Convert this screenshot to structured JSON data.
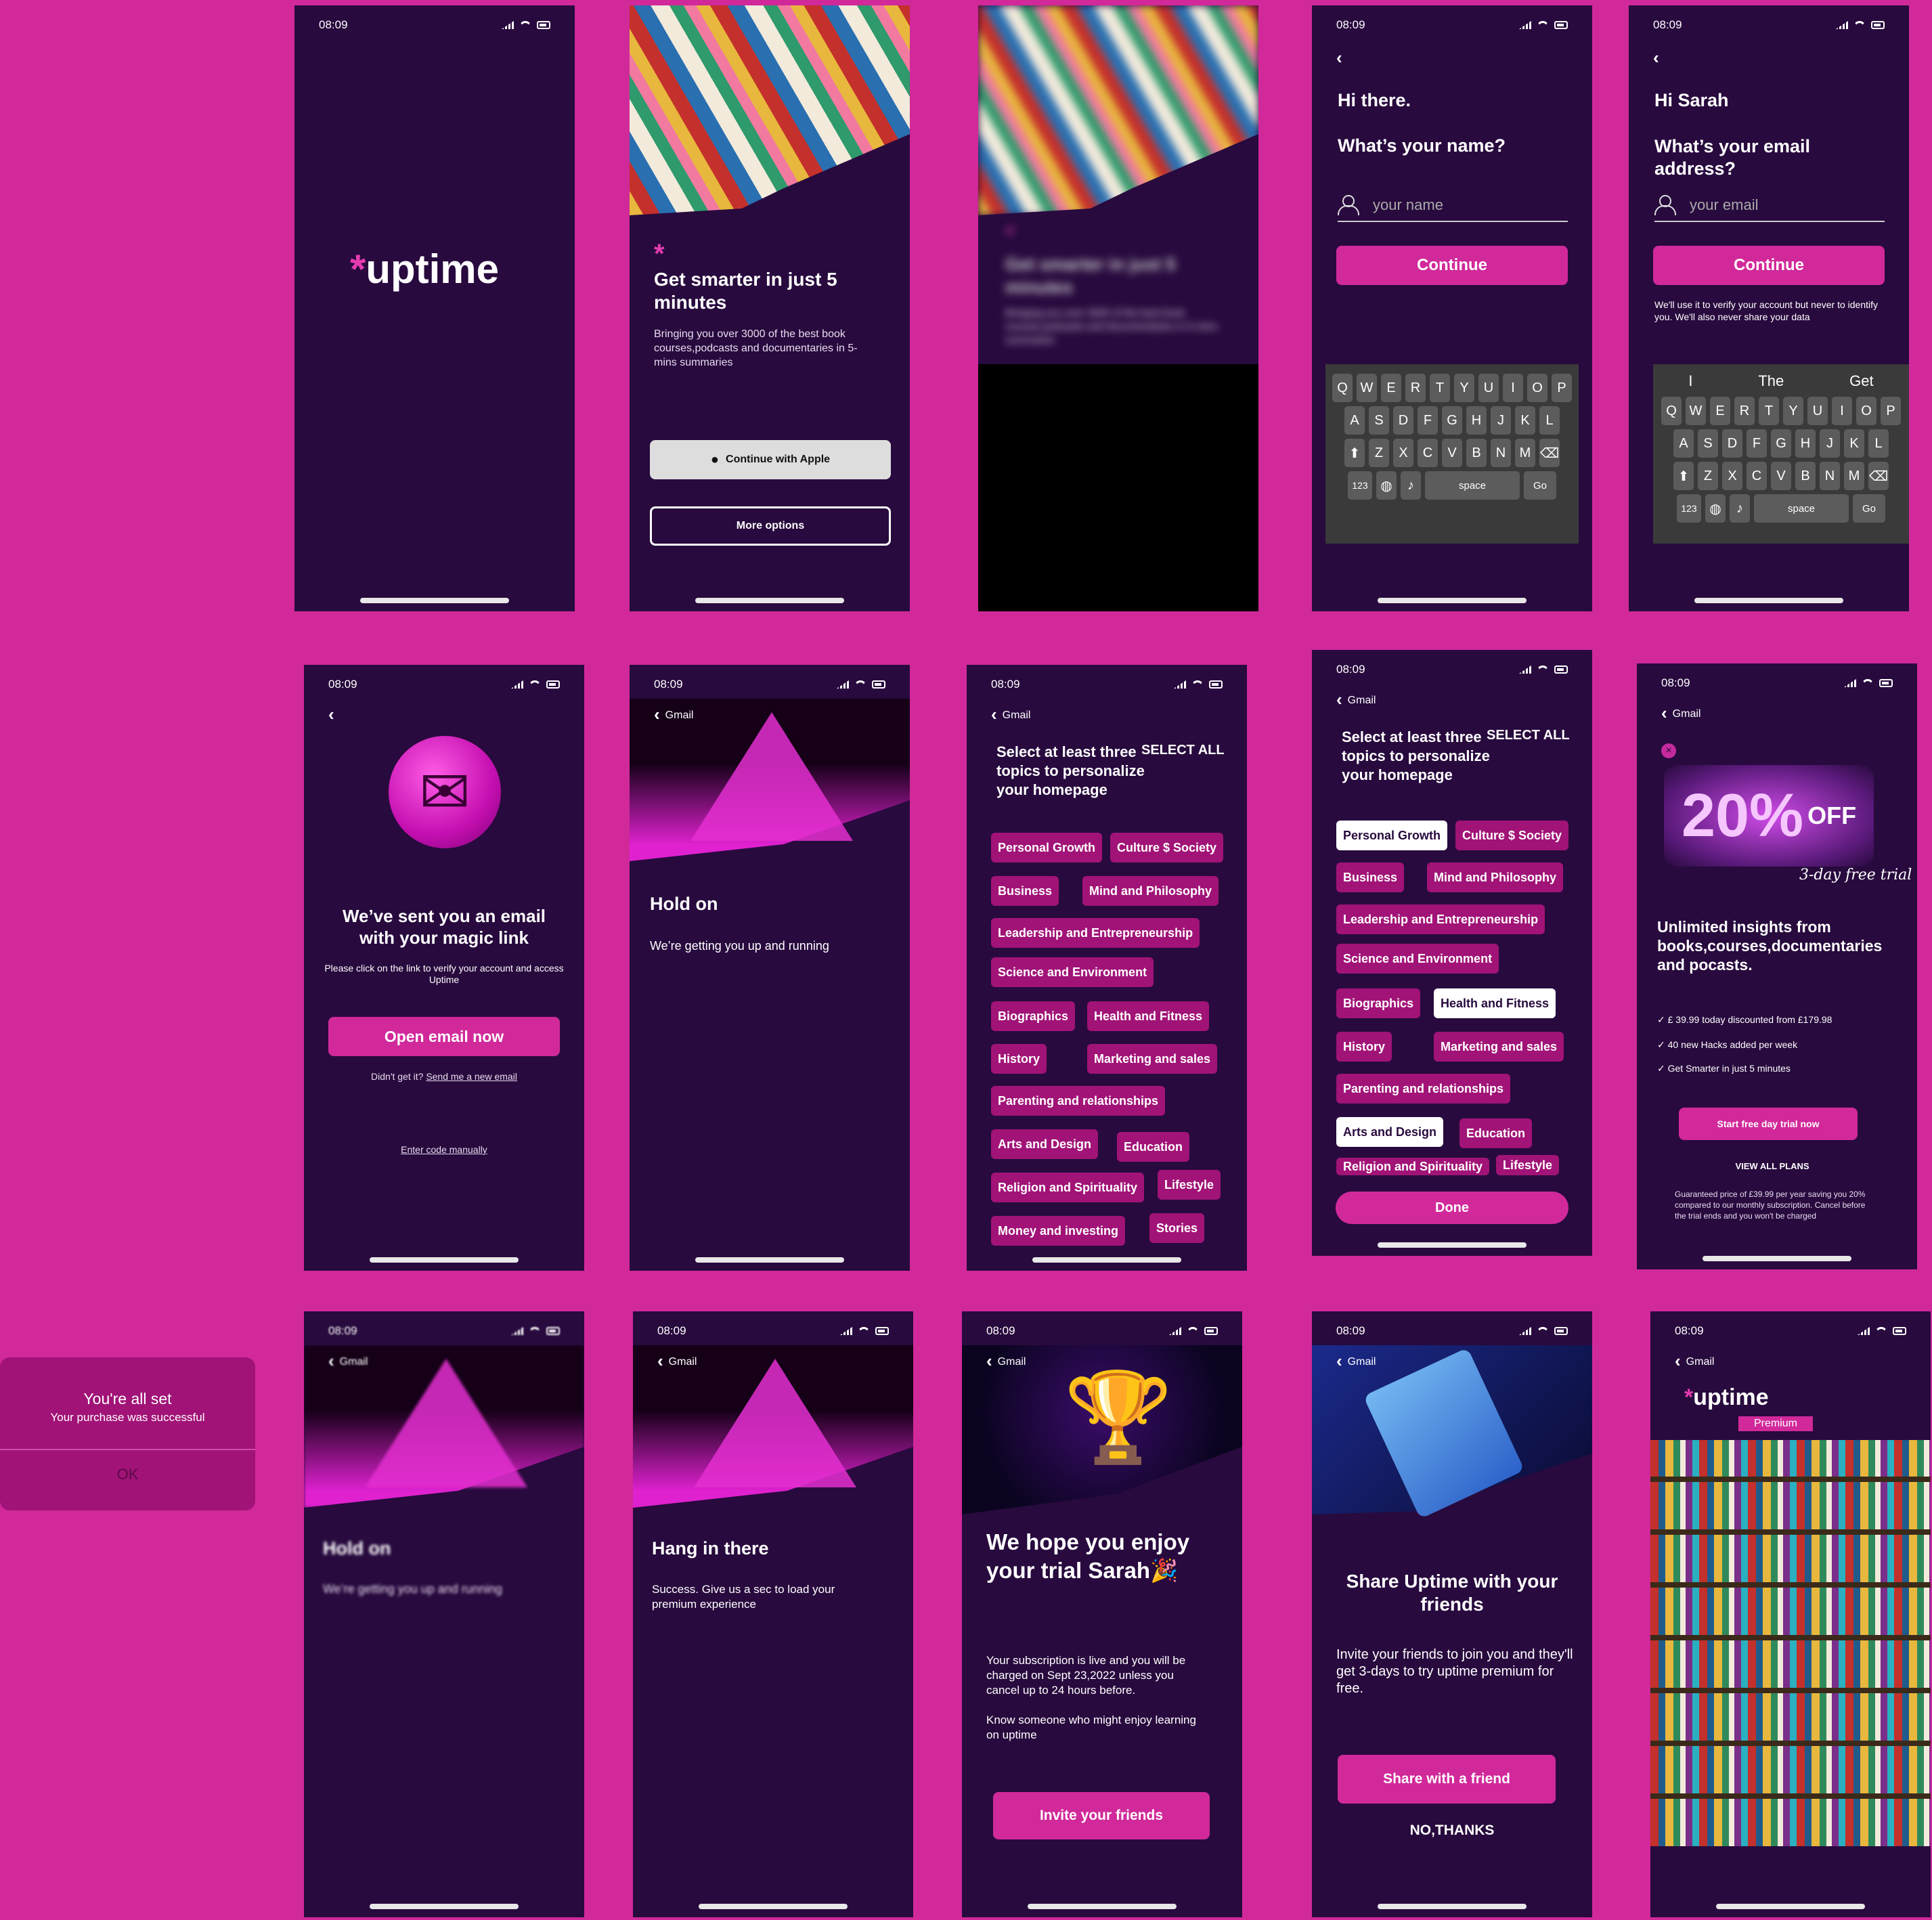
{
  "status_time": "08:09",
  "splash": {
    "logo_star": "*",
    "logo_text": "uptime"
  },
  "welcome": {
    "star": "*",
    "title": "Get smarter  in just 5 minutes",
    "subtitle": "Bringing you over 3000 of the best book courses,podcasts and documentaries in 5-mins summaries",
    "apple_button": "Continue with Apple",
    "more_options": "More options"
  },
  "welcome_blur": {
    "star": "*",
    "title": "Get smarter  in just 5 minutes",
    "subtitle": "Bringing you over 3000 of the best book courses,podcasts and documentaries in 5-mins summaries"
  },
  "name_screen": {
    "greeting": "Hi there.",
    "question": "What’s your name?",
    "placeholder": "your name",
    "continue": "Continue"
  },
  "email_screen": {
    "greeting": "Hi Sarah",
    "question": "What’s your email address?",
    "placeholder": "your email",
    "continue": "Continue",
    "note": "We'll use it to verify your account but never to identify you. We'll also never share your data",
    "suggestions": [
      "I",
      "The",
      "Get"
    ]
  },
  "keyboard": {
    "row1": [
      "Q",
      "W",
      "E",
      "R",
      "T",
      "Y",
      "U",
      "I",
      "O",
      "P"
    ],
    "row2": [
      "A",
      "S",
      "D",
      "F",
      "G",
      "H",
      "J",
      "K",
      "L"
    ],
    "row3": [
      "Z",
      "X",
      "C",
      "V",
      "B",
      "N",
      "M"
    ],
    "num": "123",
    "space": "space",
    "go": "Go"
  },
  "magic_link": {
    "title": "We’ve sent you an email with your magic link",
    "body": "Please click on the link to verify your account and access Uptime",
    "open_button": "Open email now",
    "didnt_get": "Didn't get it?",
    "resend": "Send me a new email",
    "enter_code": "Enter code manually"
  },
  "back_gmail": "Gmail",
  "hold_on": {
    "title": "Hold on",
    "body": "We’re getting you up and running"
  },
  "topics": {
    "title": "Select at least three topics to personalize your homepage",
    "select_all": "SELECT ALL",
    "items": [
      "Personal Growth",
      "Culture $ Society",
      "Business",
      "Mind and Philosophy",
      "Leadership and Entrepreneurship",
      "Science and Environment",
      "Biographics",
      "Health and Fitness",
      "History",
      "Marketing and sales",
      "Parenting and relationships",
      "Arts and Design",
      "Education",
      "Religion and Spirituality",
      "Lifestyle",
      "Money and investing",
      "Stories"
    ],
    "done": "Done"
  },
  "promo": {
    "big": "20%",
    "off": "OFF",
    "trial_script": "3-day free trial",
    "headline": "Unlimited insights from books,courses,documentaries and pocasts.",
    "checks": [
      "£ 39.99 today discounted from £179.98",
      "40 new Hacks added per week",
      "Get Smarter in just 5 minutes"
    ],
    "start_button": "Start free day trial now",
    "view_all": "VIEW ALL PLANS",
    "fine_print": "Guaranteed price of £39.99 per year saving you 20% compared to our monthly subscription. Cancel before the trial ends and you won't be charged"
  },
  "dialog": {
    "title": "You're all set",
    "body": "Your purchase was successful",
    "ok": "OK"
  },
  "hang_in": {
    "title": "Hang in there",
    "body": "Success. Give us a sec to load your premium experience"
  },
  "trial": {
    "title": "We hope you enjoy your trial Sarah🎉",
    "body1": "Your subscription is live and you will be charged on Sept 23,2022 unless you cancel up to 24 hours before.",
    "body2": "Know someone who might enjoy learning on uptime",
    "button": "Invite your friends"
  },
  "share": {
    "title": "Share Uptime with your friends",
    "body": "Invite your friends to join you and they'll get 3-days to try uptime premium for free.",
    "button": "Share with a friend",
    "no": "NO,THANKS"
  },
  "premium": {
    "star": "*",
    "logo": "uptime",
    "badge": "Premium"
  },
  "colors": {
    "brand": "#d1299a",
    "bg": "#280a3e",
    "chip": "#a11377"
  }
}
